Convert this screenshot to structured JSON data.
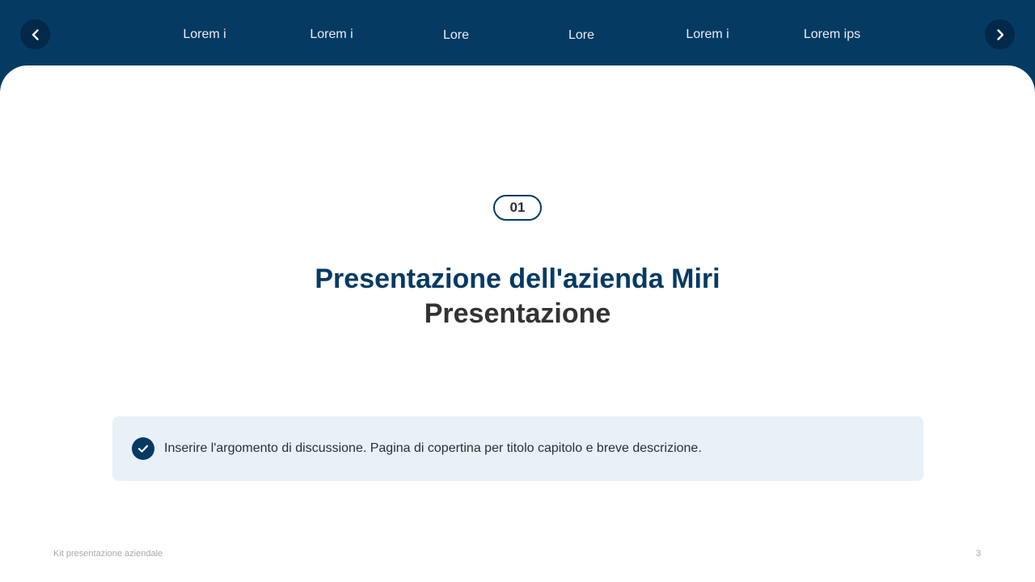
{
  "nav": {
    "prev_icon": "chevron-left-icon",
    "next_icon": "chevron-right-icon",
    "tabs": [
      "Lorem i",
      "Lorem i",
      "Lore",
      "Lore",
      "Lorem i",
      "Lorem ips"
    ]
  },
  "slide": {
    "chapter_number": "01",
    "title": "Presentazione dell'azienda Miri",
    "subtitle": "Presentazione",
    "info_icon": "check-circle-icon",
    "info_text": "Inserire l'argomento di discussione. Pagina di copertina per titolo capitolo e breve descrizione."
  },
  "footer": {
    "left_text": "Kit presentazione aziendale",
    "page_number": "3"
  },
  "colors": {
    "header_bg": "#053a63",
    "nav_button_bg": "#02284a",
    "title_accent": "#053a63",
    "info_box_bg": "#e9f0f8"
  }
}
